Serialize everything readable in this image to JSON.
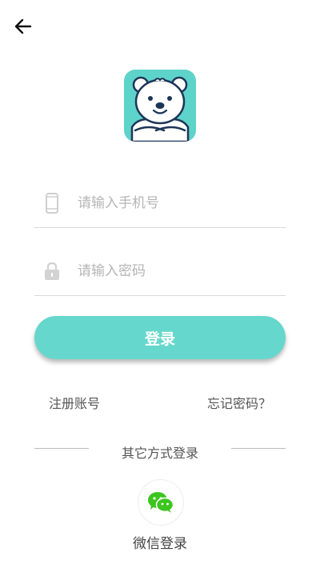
{
  "header": {
    "back_icon": "arrow-left-icon"
  },
  "logo": {
    "icon": "polar-bear-logo",
    "bg_color": "#5ed3c9"
  },
  "form": {
    "phone_placeholder": "请输入手机号",
    "phone_value": "",
    "phone_icon": "mobile-phone-icon",
    "password_placeholder": "请输入密码",
    "password_value": "",
    "password_icon": "lock-icon",
    "login_label": "登录",
    "accent_color": "#66d7cc"
  },
  "links": {
    "register": "注册账号",
    "forgot_password": "忘记密码？"
  },
  "other_login": {
    "title": "其它方式登录",
    "wechat_label": "微信登录",
    "wechat_icon": "wechat-icon",
    "wechat_color": "#3cc51f"
  }
}
